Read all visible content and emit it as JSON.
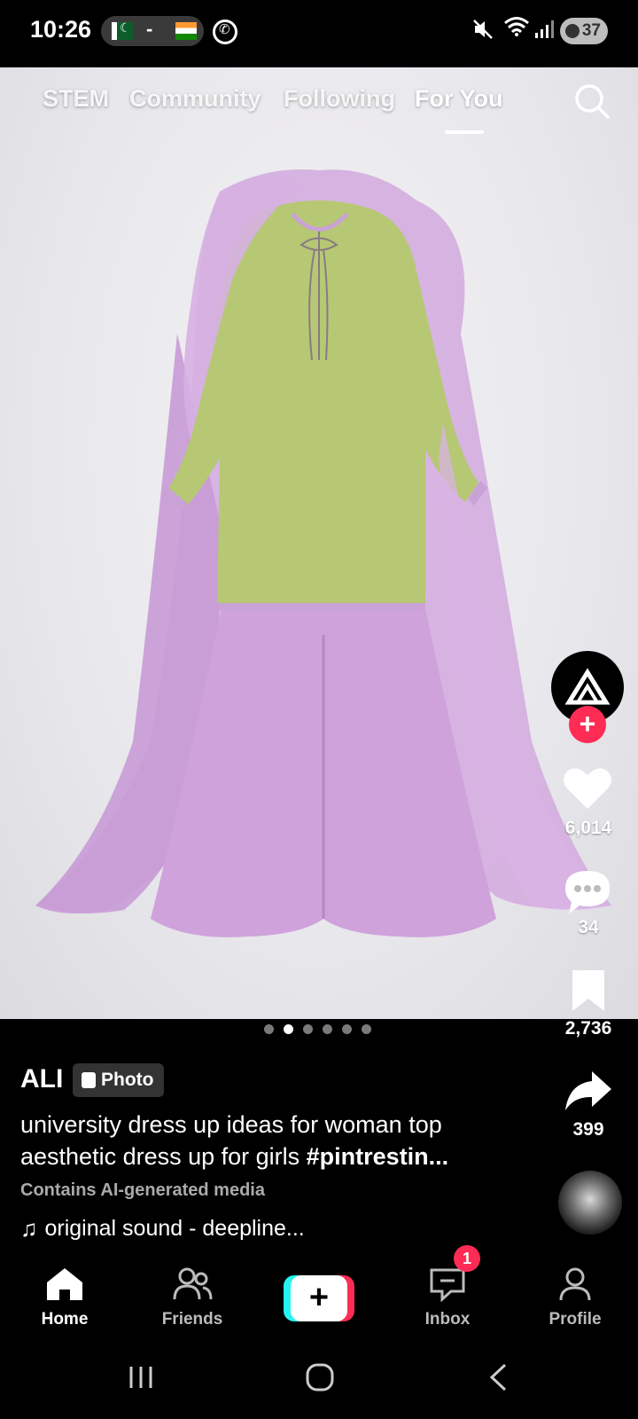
{
  "status_bar": {
    "time": "10:26",
    "pill_separator": "-",
    "battery": "37"
  },
  "top_tabs": [
    {
      "label": "STEM",
      "active": false
    },
    {
      "label": "Community",
      "active": false
    },
    {
      "label": "Following",
      "active": false
    },
    {
      "label": "For You",
      "active": true
    }
  ],
  "icons": {
    "search": "search-icon",
    "like": "heart-icon",
    "comment": "comment-icon",
    "save": "bookmark-icon",
    "share": "share-icon"
  },
  "rail": {
    "follow_symbol": "+",
    "likes": "6,014",
    "comments": "34",
    "saves": "2,736",
    "shares": "399"
  },
  "carousel": {
    "total": 6,
    "active_index": 1
  },
  "post": {
    "author": "ALI",
    "badge": "Photo",
    "caption_text": "university dress up ideas for woman top aesthetic dress up for girls ",
    "caption_hashtag": "#pintrestin...",
    "ai_label": "Contains AI-generated media",
    "sound": "original sound - deepline..."
  },
  "bottom_nav": {
    "home": "Home",
    "friends": "Friends",
    "create": "+",
    "inbox": "Inbox",
    "inbox_badge": "1",
    "profile": "Profile"
  },
  "colors": {
    "accent": "#fe2c55",
    "cyan": "#25f4ee",
    "kurta": "#b6c873",
    "trim": "#c9a2d6",
    "dupatta": "#d2a9de"
  }
}
